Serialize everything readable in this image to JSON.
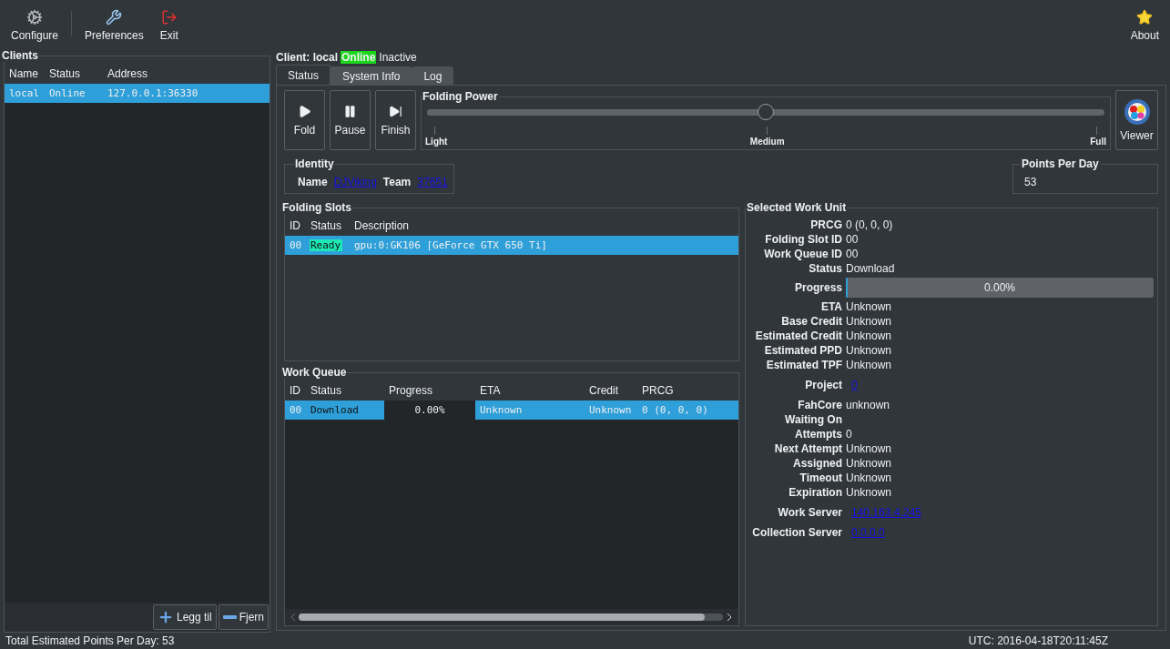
{
  "toolbar": {
    "buttons": [
      {
        "label": "Configure",
        "kind": "gears"
      },
      {
        "label": "Preferences",
        "kind": "tools"
      },
      {
        "label": "Exit",
        "kind": "exit"
      }
    ],
    "about": {
      "label": "About"
    }
  },
  "clients": {
    "title": "Clients",
    "columns": [
      "Name",
      "Status",
      "Address"
    ],
    "rows": [
      {
        "cells": [
          "local",
          "Online",
          "127.0.0.1:36330"
        ],
        "selected": true
      }
    ],
    "buttons": [
      {
        "label": "Legg til",
        "kind": "add"
      },
      {
        "label": "Fjern",
        "kind": "remove"
      }
    ]
  },
  "client_header": {
    "label": "Client: local",
    "status": "Online",
    "state": "Inactive"
  },
  "tabs": [
    {
      "label": "Status",
      "selected": true
    },
    {
      "label": "System Info",
      "selected": false
    },
    {
      "label": "Log",
      "selected": false
    }
  ],
  "controls": [
    {
      "label": "Fold",
      "kind": "play"
    },
    {
      "label": "Pause",
      "kind": "pause"
    },
    {
      "label": "Finish",
      "kind": "finish"
    }
  ],
  "folding_power": {
    "title": "Folding Power",
    "level": 0.5,
    "ticks": [
      "Light",
      "Medium",
      "Full"
    ]
  },
  "viewer": {
    "label": "Viewer"
  },
  "identity": {
    "title": "Identity",
    "name_label": "Name",
    "name": "DJViking",
    "team_label": "Team",
    "team": "37651"
  },
  "points_per_day": {
    "title": "Points Per Day",
    "value": "53"
  },
  "folding_slots": {
    "title": "Folding Slots",
    "columns": [
      "ID",
      "Status",
      "Description"
    ],
    "rows": [
      {
        "id": "00",
        "status": "Ready",
        "color": "#1de9b6",
        "description": "gpu:0:GK106 [GeForce GTX 650 Ti]",
        "selected": true
      }
    ]
  },
  "work_queue": {
    "title": "Work Queue",
    "columns": [
      "ID",
      "Status",
      "Progress",
      "ETA",
      "Credit",
      "PRCG"
    ],
    "rows": [
      {
        "id": "00",
        "status": "Download",
        "progress": "0.00%",
        "eta": "Unknown",
        "credit": "Unknown",
        "prcg": "0 (0, 0, 0)",
        "selected": true
      }
    ]
  },
  "work_unit": {
    "title": "Selected Work Unit",
    "groups": [
      [
        {
          "label": "PRCG",
          "value": "0 (0, 0, 0)",
          "kind": "text"
        },
        {
          "label": "Folding Slot ID",
          "value": "00",
          "kind": "text"
        },
        {
          "label": "Work Queue ID",
          "value": "00",
          "kind": "text"
        },
        {
          "label": "Status",
          "value": "Download",
          "kind": "text"
        },
        {
          "label": "Progress",
          "value": "0.00%",
          "kind": "progress",
          "level": 0
        },
        {
          "label": "ETA",
          "value": "Unknown",
          "kind": "text"
        },
        {
          "label": "Base Credit",
          "value": "Unknown",
          "kind": "text"
        },
        {
          "label": "Estimated Credit",
          "value": "Unknown",
          "kind": "text"
        },
        {
          "label": "Estimated PPD",
          "value": "Unknown",
          "kind": "text"
        },
        {
          "label": "Estimated TPF",
          "value": "Unknown",
          "kind": "text"
        }
      ],
      [
        {
          "label": "Project",
          "value": "0",
          "kind": "link"
        }
      ],
      [
        {
          "label": "FahCore",
          "value": "unknown",
          "kind": "text"
        },
        {
          "label": "Waiting On",
          "kind": "text"
        },
        {
          "label": "Attempts",
          "value": "0",
          "kind": "text"
        },
        {
          "label": "Next Attempt",
          "value": "Unknown",
          "kind": "text"
        },
        {
          "label": "Assigned",
          "value": "Unknown",
          "kind": "text"
        },
        {
          "label": "Timeout",
          "value": "Unknown",
          "kind": "text"
        },
        {
          "label": "Expiration",
          "value": "Unknown",
          "kind": "text"
        }
      ],
      [
        {
          "label": "Work Server",
          "value": "140.163.4.245",
          "kind": "link"
        }
      ],
      [
        {
          "label": "Collection Server",
          "value": "0.0.0.0",
          "kind": "link"
        }
      ]
    ]
  },
  "status_bar": {
    "left": "Total Estimated Points Per Day: 53",
    "right": "UTC: 2016-04-18T20:11:45Z"
  }
}
